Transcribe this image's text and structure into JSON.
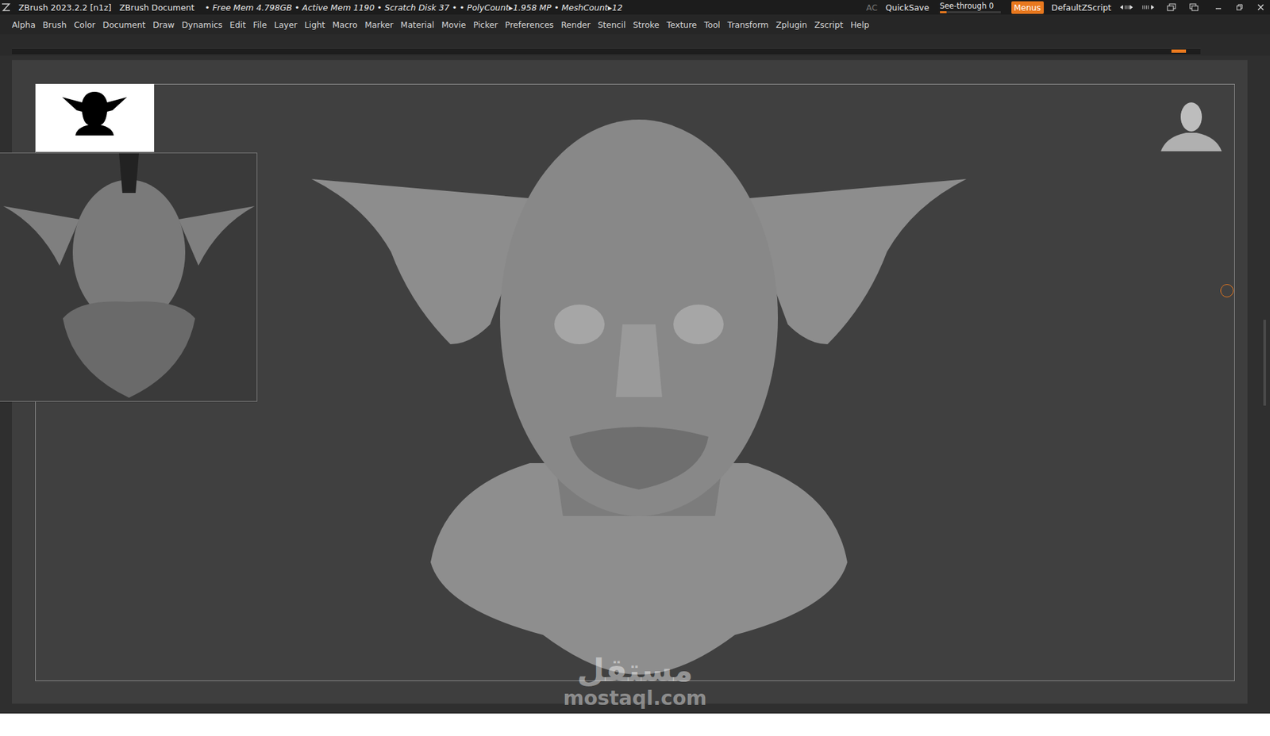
{
  "window": {
    "app": "ZBrush 2023.2.2 [n1z]",
    "document": "ZBrush Document",
    "stats": "• Free Mem 4.798GB • Active Mem 1190 • Scratch Disk 37 • • PolyCount▸1.958 MP • MeshCount▸12"
  },
  "title_controls": {
    "ac": "AC",
    "quicksave": "QuickSave",
    "see_through": {
      "label": "See-through",
      "reading": "0",
      "level": 0
    },
    "menus": {
      "label": "Menus",
      "selected": true
    },
    "script": "DefaultZScript"
  },
  "menu": [
    "Alpha",
    "Brush",
    "Color",
    "Document",
    "Draw",
    "Dynamics",
    "Edit",
    "File",
    "Layer",
    "Light",
    "Macro",
    "Marker",
    "Material",
    "Movie",
    "Picker",
    "Preferences",
    "Render",
    "Stencil",
    "Stroke",
    "Texture",
    "Tool",
    "Transform",
    "Zplugin",
    "Zscript",
    "Help"
  ],
  "watermark": {
    "arabic": "مستقل",
    "latin": "mostaql.com"
  }
}
